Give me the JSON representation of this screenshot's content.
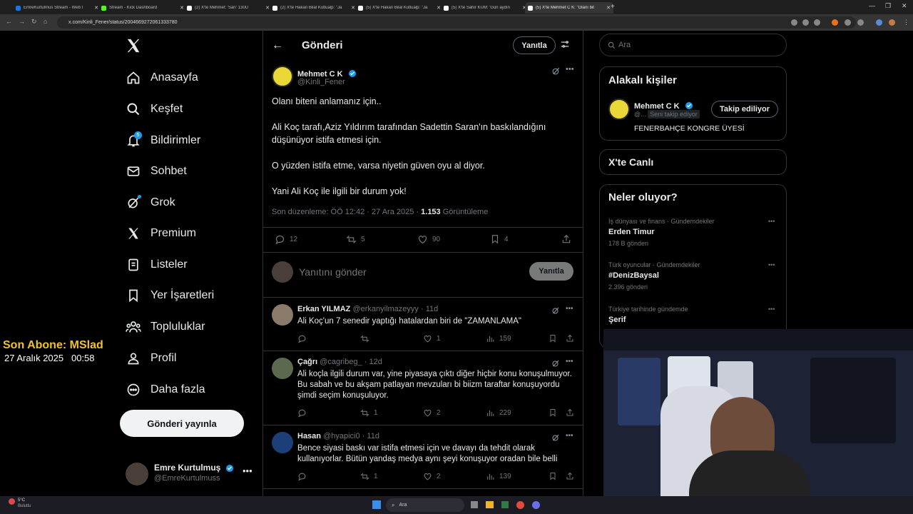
{
  "browser": {
    "tabs": [
      {
        "title": "EmreKurtulmus Stream - Web İ",
        "color": "#1a73e8"
      },
      {
        "title": "Stream - Kick Dashboard",
        "color": "#53fc18"
      },
      {
        "title": "(2) X'te Mehmet: 'Sarı' 130U",
        "color": "#ffffff"
      },
      {
        "title": "(2) X'te Hakan Bilal Kutlualp: \"Ja",
        "color": "#ffffff"
      },
      {
        "title": "(5) X'te Hakan Bilal Kutlualp: \"Ja",
        "color": "#ffffff"
      },
      {
        "title": "(5) X'te Sahir KUM: 'Gün aydın",
        "color": "#ffffff"
      },
      {
        "title": "(5) X'te Mehmet C K: \"Olanı bit",
        "color": "#ffffff"
      }
    ],
    "url": "x.com/Kinli_Fener/status/2004669272061333780"
  },
  "nav": {
    "items": [
      {
        "label": "Anasayfa",
        "icon": "home-icon"
      },
      {
        "label": "Keşfet",
        "icon": "search-icon"
      },
      {
        "label": "Bildirimler",
        "icon": "bell-icon",
        "badge": "5"
      },
      {
        "label": "Sohbet",
        "icon": "mail-icon"
      },
      {
        "label": "Grok",
        "icon": "grok-icon"
      },
      {
        "label": "Premium",
        "icon": "x-logo-icon"
      },
      {
        "label": "Listeler",
        "icon": "list-icon"
      },
      {
        "label": "Yer İşaretleri",
        "icon": "bookmark-icon"
      },
      {
        "label": "Topluluklar",
        "icon": "people-icon"
      },
      {
        "label": "Profil",
        "icon": "person-icon"
      },
      {
        "label": "Daha fazla",
        "icon": "more-circle-icon"
      }
    ],
    "post_button": "Gönderi yayınla",
    "account": {
      "name": "Emre Kurtulmuş",
      "handle": "@EmreKurtulmuss"
    }
  },
  "header": {
    "title": "Gönderi",
    "reply_button": "Yanıtla"
  },
  "post": {
    "author": "Mehmet C K",
    "handle": "@Kinli_Fener",
    "lines": [
      "Olanı biteni anlamanız için..",
      "Ali Koç tarafı,Aziz Yıldırım tarafından Sadettin Saran'ın baskılandığını",
      "düşünüyor istifa etmesi için.",
      "O yüzden istifa etme, varsa niyetin güven oyu al diyor.",
      "Yani Ali Koç ile ilgili bir durum yok!"
    ],
    "meta": "Son düzenleme: ÖÖ 12:42 · 27 Ara 2025 ·",
    "views": "1.153",
    "views_label": "Görüntüleme",
    "replies": "12",
    "reposts": "5",
    "likes": "90",
    "bookmarks": "4"
  },
  "composer": {
    "placeholder": "Yanıtını gönder",
    "button": "Yanıtla"
  },
  "replies": [
    {
      "name": "Erkan YILMAZ",
      "handle": "@erkanyilmazeyyy",
      "time": "· 11d",
      "lines": [
        "Ali Koç'un 7 senedir yaptığı hatalardan biri de \"ZAMANLAMA\""
      ],
      "replies": "",
      "reposts": "",
      "likes": "1",
      "views": "159"
    },
    {
      "name": "Çağrı",
      "handle": "@cagribeg_",
      "time": "· 12d",
      "lines": [
        "Ali koçla ilgili durum var, yine piyasaya çıktı diğer hiçbir konu konuşulmuyor.",
        "Bu sabah ve bu akşam patlayan mevzuları bi biizm taraftar konuşuyordu",
        "şimdi seçim konuşuluyor."
      ],
      "replies": "",
      "reposts": "1",
      "likes": "2",
      "views": "229"
    },
    {
      "name": "Hasan",
      "handle": "@hyapici0",
      "time": "· 11d",
      "lines": [
        "Bence siyasi baskı var istifa etmesi için ve davayı da tehdit olarak",
        "kullanıyorlar. Bütün yandaş medya aynı şeyi konuşuyor oradan bile belli"
      ],
      "replies": "",
      "reposts": "1",
      "likes": "2",
      "views": "139"
    }
  ],
  "right": {
    "search_placeholder": "Ara",
    "related_title": "Alakalı kişiler",
    "related_person": {
      "name": "Mehmet C K",
      "handle": "@...",
      "follows_you": "Seni takip ediyor",
      "button": "Takip ediliyor",
      "bio": "FENERBAHÇE KONGRE ÜYESİ"
    },
    "live_title": "X'te Canlı",
    "trends_title": "Neler oluyor?",
    "trends": [
      {
        "category": "İş dünyası ve finans · Gündemdekiler",
        "title": "Erden Timur",
        "count": "178 B gönderi"
      },
      {
        "category": "Türk oyuncular · Gündemdekiler",
        "title": "#DenizBaysal",
        "count": "2.396 gönderi"
      },
      {
        "category": "Türkiye tarihinde gündemde",
        "title": "Şerif",
        "count": ""
      }
    ]
  },
  "overlay": {
    "subscriber": "Son Abone: MSlad",
    "date": "27 Aralık 2025",
    "time": "00:58"
  },
  "taskbar": {
    "weather_temp": "5°C",
    "weather_label": "Bulutlu",
    "search": "Ara"
  },
  "colors": {
    "accent": "#1d9bf0",
    "verified": "#1d9bf0",
    "border": "#2f3336",
    "muted": "#71767b",
    "overlay_yellow": "#f0c22e"
  }
}
